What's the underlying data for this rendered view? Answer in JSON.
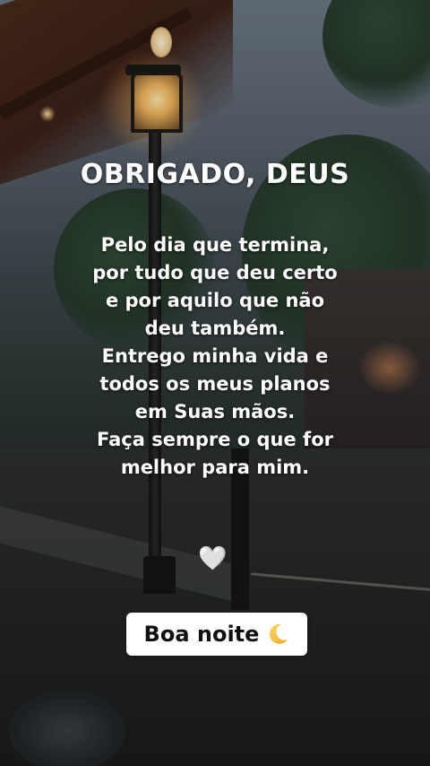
{
  "title": "OBRIGADO, DEUS",
  "message_lines": [
    "Pelo dia que termina,",
    "por tudo que deu certo",
    "e por aquilo que não",
    "deu também.",
    "Entrego minha vida e",
    "todos os meus planos",
    "em Suas mãos.",
    "Faça sempre o que for",
    "melhor para mim."
  ],
  "heart_glyph": "🤍",
  "greeting_badge": {
    "label": "Boa noite",
    "icon": "crescent-moon-icon"
  },
  "colors": {
    "text": "#ffffff",
    "badge_background": "#ffffff",
    "badge_text": "#111111",
    "moon": "#f5c542"
  }
}
